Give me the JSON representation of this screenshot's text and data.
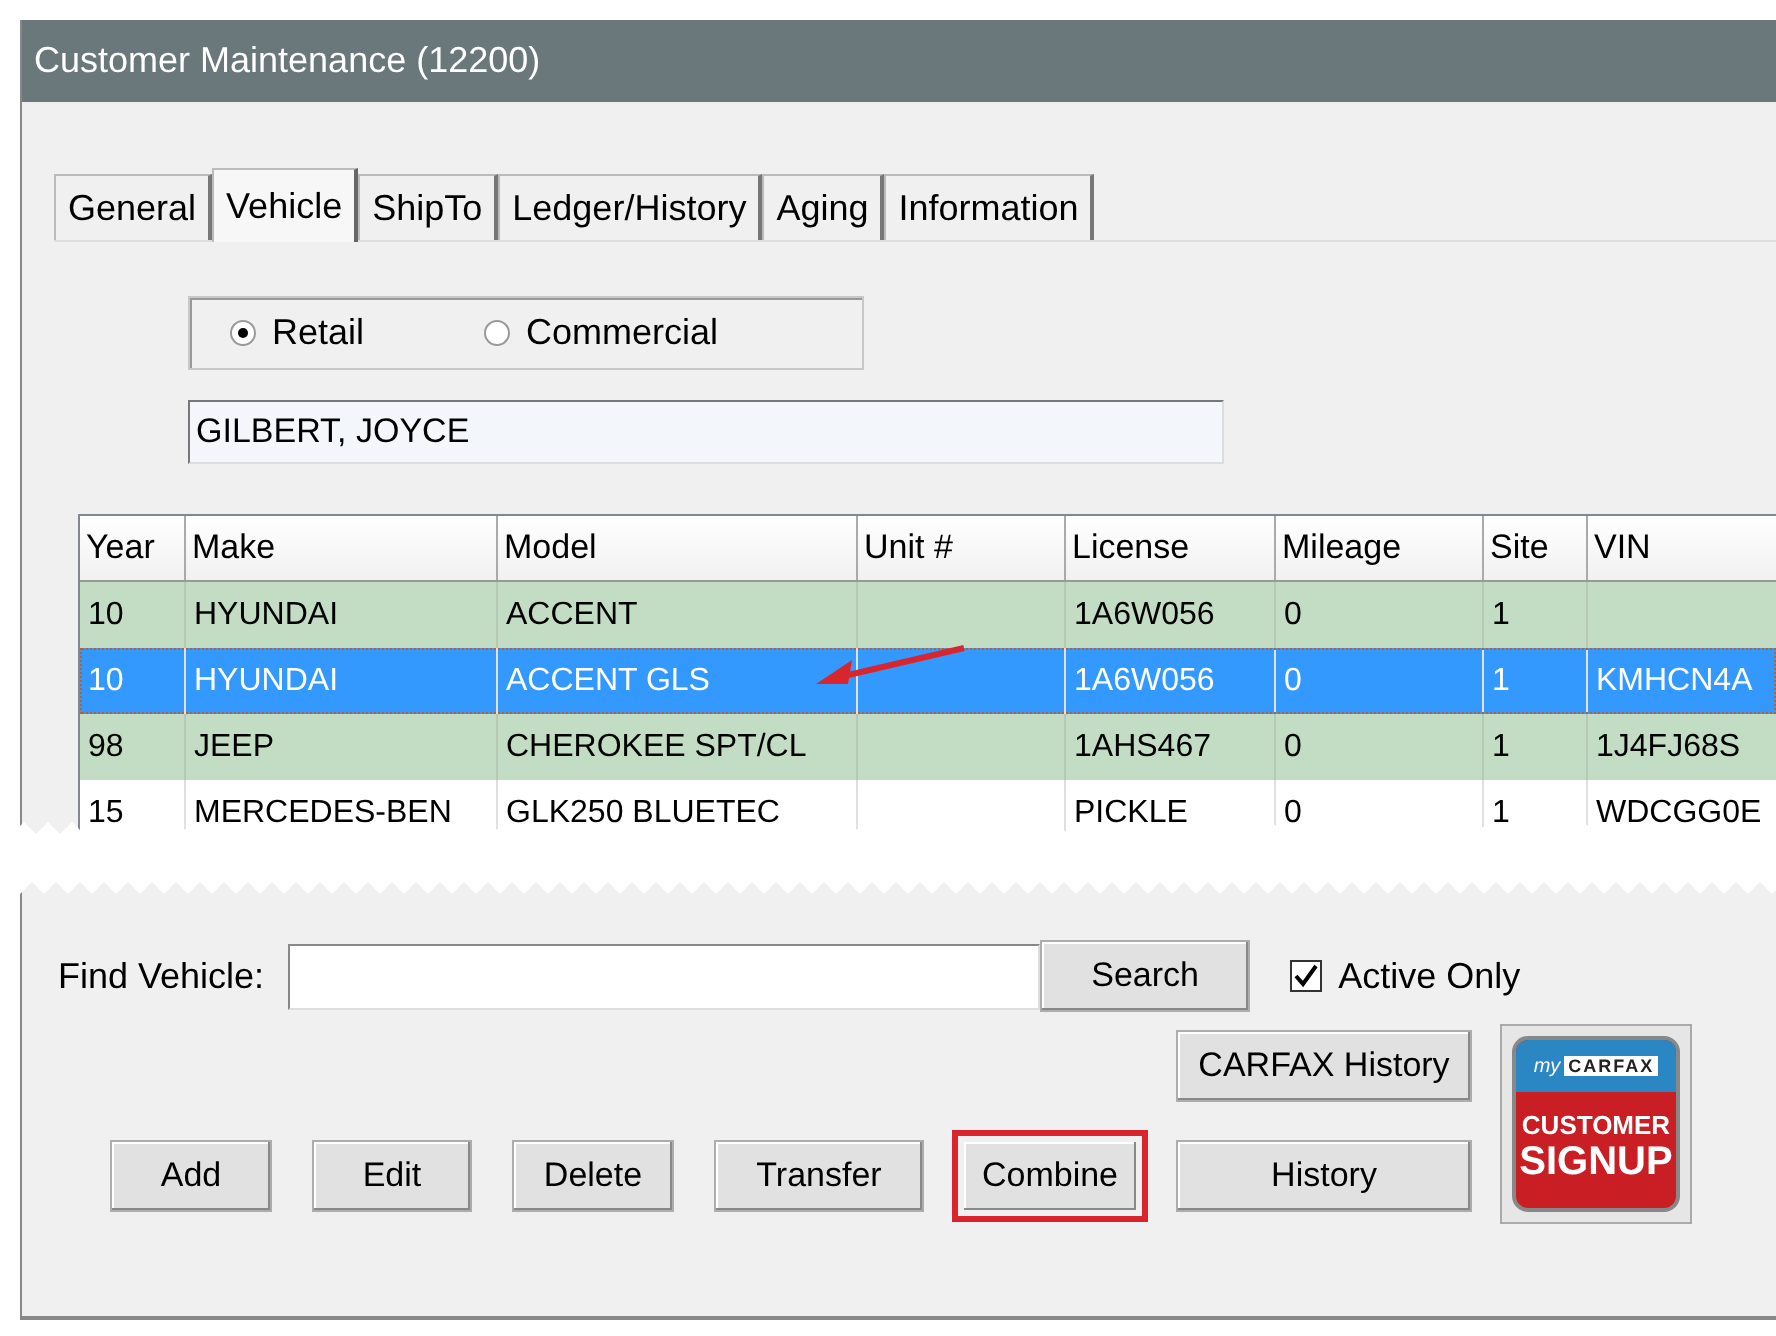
{
  "window": {
    "title": "Customer Maintenance (12200)"
  },
  "tabs": [
    {
      "label": "General",
      "selected": false
    },
    {
      "label": "Vehicle",
      "selected": true
    },
    {
      "label": "ShipTo",
      "selected": false
    },
    {
      "label": "Ledger/History",
      "selected": false
    },
    {
      "label": "Aging",
      "selected": false
    },
    {
      "label": "Information",
      "selected": false
    }
  ],
  "customer_type": [
    {
      "label": "Retail",
      "selected": true
    },
    {
      "label": "Commercial",
      "selected": false
    }
  ],
  "customer_name": {
    "value": "GILBERT, JOYCE"
  },
  "table": {
    "columns": [
      "Year",
      "Make",
      "Model",
      "Unit #",
      "License",
      "Mileage",
      "Site",
      "VIN"
    ],
    "rows": [
      {
        "cells": [
          "10",
          "HYUNDAI",
          "ACCENT",
          "",
          "1A6W056",
          "0",
          "1",
          ""
        ],
        "selected": false,
        "highlighted": true
      },
      {
        "cells": [
          "10",
          "HYUNDAI",
          "ACCENT GLS",
          "",
          "1A6W056",
          "0",
          "1",
          "KMHCN4A"
        ],
        "selected": true,
        "highlighted": false
      },
      {
        "cells": [
          "98",
          "JEEP",
          "CHEROKEE SPT/CL",
          "",
          "1AHS467",
          "0",
          "1",
          "1J4FJ68S"
        ],
        "selected": false,
        "highlighted": true
      },
      {
        "cells": [
          "15",
          "MERCEDES-BEN",
          "GLK250 BLUETEC",
          "",
          "PICKLE",
          "0",
          "1",
          "WDCGG0E"
        ],
        "selected": false,
        "highlighted": false
      }
    ]
  },
  "find_vehicle": {
    "label": "Find Vehicle:"
  },
  "search_button": {
    "label": "Search"
  },
  "active_only": {
    "label": "Active Only",
    "checked": true
  },
  "carfax_history_button": {
    "label": "CARFAX History"
  },
  "buttons": [
    {
      "label": "Add",
      "highlighted": false
    },
    {
      "label": "Edit",
      "highlighted": false
    },
    {
      "label": "Delete",
      "highlighted": false
    },
    {
      "label": "Transfer",
      "highlighted": false
    },
    {
      "label": "Combine",
      "highlighted": true
    },
    {
      "label": "History",
      "highlighted": false
    }
  ],
  "carfax_badge": {
    "prefix": "my",
    "brand": "CARFAX",
    "line_1": "CUSTOMER",
    "line_2": "SIGNUP"
  }
}
